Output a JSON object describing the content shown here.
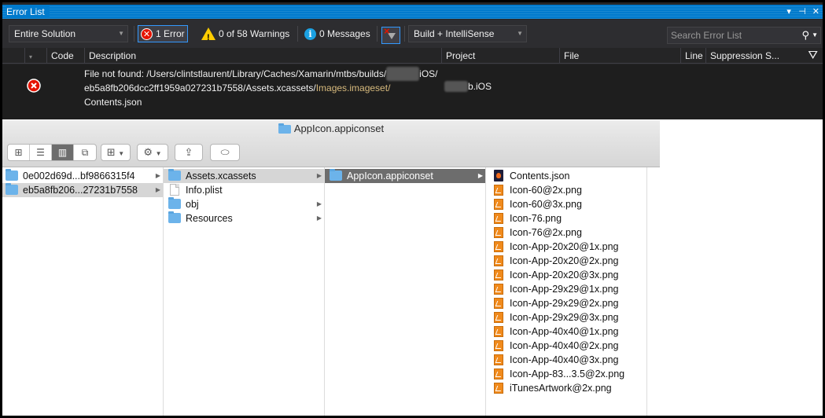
{
  "error_list": {
    "title": "Error List",
    "window_buttons": [
      "▾",
      "⊣",
      "✕"
    ],
    "scope": "Entire Solution",
    "errors_label": "1 Error",
    "warnings_label": "0 of 58 Warnings",
    "messages_label": "0 Messages",
    "build_filter": "Build + IntelliSense",
    "search_placeholder": "Search Error List",
    "columns": [
      "Code",
      "Description",
      "Project",
      "File",
      "Line",
      "Suppression S..."
    ],
    "row": {
      "desc_part1": "File not found: /Users/clintstlaurent/Library/Caches/Xamarin/mtbs/builds/",
      "desc_redacted1": "xxxxxxx",
      "desc_part2": "iOS/",
      "desc_part3": "eb5a8fb206dcc2ff1959a027231b7558/Assets.xcassets/",
      "desc_highlight": "Images.imageset/",
      "desc_part4": "Contents.json",
      "project_redacted": "xxxxx",
      "project_suffix": "b.iOS"
    }
  },
  "finder": {
    "title": "AppIcon.appiconset",
    "col1": [
      "0e002d69d...bf9866315f4",
      "eb5a8fb206...27231b7558"
    ],
    "col2": [
      "Assets.xcassets",
      "Info.plist",
      "obj",
      "Resources"
    ],
    "col3": [
      "AppIcon.appiconset"
    ],
    "col4": [
      "Contents.json",
      "Icon-60@2x.png",
      "Icon-60@3x.png",
      "Icon-76.png",
      "Icon-76@2x.png",
      "Icon-App-20x20@1x.png",
      "Icon-App-20x20@2x.png",
      "Icon-App-20x20@3x.png",
      "Icon-App-29x29@1x.png",
      "Icon-App-29x29@2x.png",
      "Icon-App-29x29@3x.png",
      "Icon-App-40x40@1x.png",
      "Icon-App-40x40@2x.png",
      "Icon-App-40x40@3x.png",
      "Icon-App-83...3.5@2x.png",
      "iTunesArtwork@2x.png"
    ]
  }
}
